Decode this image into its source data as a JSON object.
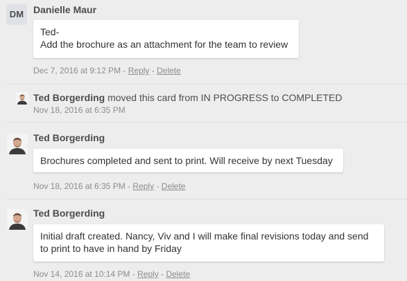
{
  "comments": [
    {
      "author": "Danielle Maur",
      "avatar_initials": "DM",
      "text_lines": [
        "Ted-",
        "Add the brochure as an attachment for the team to review"
      ],
      "timestamp": "Dec 7, 2016 at 9:12 PM",
      "separator_1": " - ",
      "reply_label": "Reply",
      "separator_2": " - ",
      "delete_label": "Delete"
    },
    {
      "author": "Ted Borgerding",
      "text_lines": [
        "Brochures completed and sent to print. Will receive by next Tuesday"
      ],
      "timestamp": "Nov 18, 2016 at 6:35 PM",
      "separator_1": " - ",
      "reply_label": "Reply",
      "separator_2": " - ",
      "delete_label": "Delete"
    },
    {
      "author": "Ted Borgerding",
      "text_lines": [
        "Initial draft created. Nancy, Viv and I will make final revisions today and send",
        "to print to have in hand by Friday"
      ],
      "timestamp": "Nov 14, 2016 at 10:14 PM",
      "separator_1": " - ",
      "reply_label": "Reply",
      "separator_2": " - ",
      "delete_label": "Delete"
    }
  ],
  "activity": {
    "author": "Ted Borgerding",
    "action": " moved this card from IN PROGRESS to COMPLETED",
    "timestamp": "Nov 18, 2016 at 6:35 PM"
  },
  "colors": {
    "background": "#ededed",
    "bubble": "#ffffff",
    "meta_text": "#8c8c8c",
    "author_text": "#4d4d4d"
  }
}
